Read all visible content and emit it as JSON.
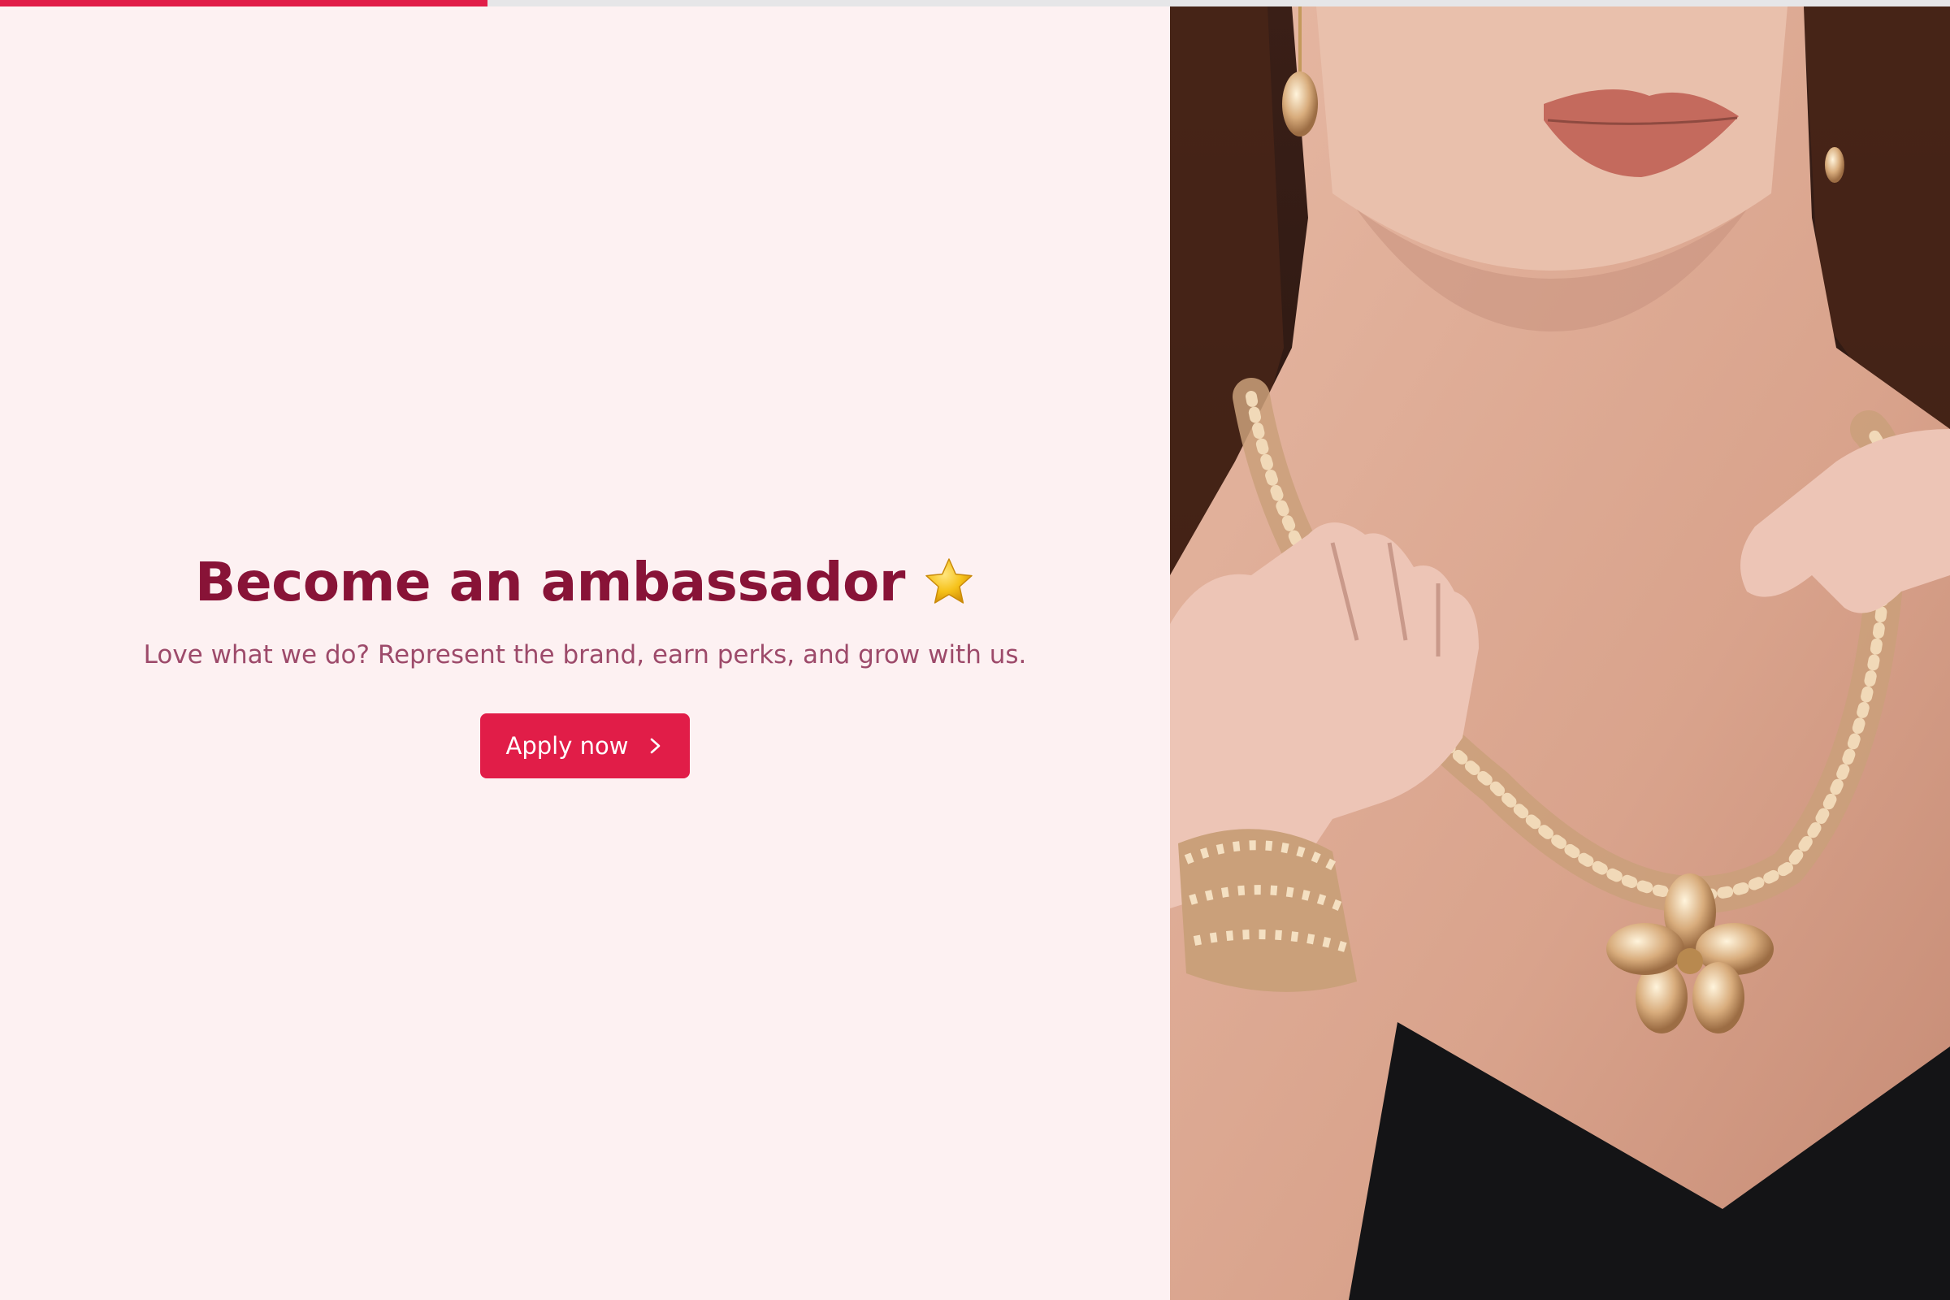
{
  "progress": {
    "value_percent": 25,
    "color": "#e11d48",
    "track_color": "#e6e6e8"
  },
  "hero": {
    "title": "Become an ambassador",
    "title_icon": "star-icon",
    "subtitle": "Love what we do? Represent the brand, earn perks, and grow with us.",
    "cta_label": "Apply now",
    "cta_icon": "chevron-right-icon"
  },
  "colors": {
    "background": "#fdf1f2",
    "heading": "#881337",
    "subtitle": "#9d4a6a",
    "accent": "#e11d48"
  },
  "photo": {
    "subject": "woman wearing crystal bead necklace and bracelet"
  }
}
